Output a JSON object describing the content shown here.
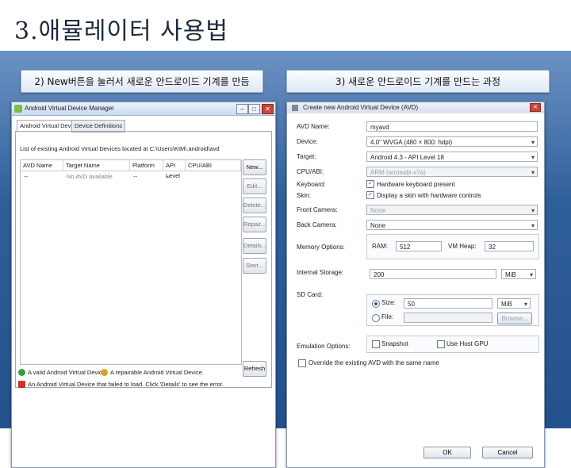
{
  "slide": {
    "title": "3.애뮬레이터 사용법",
    "caption_left": "2) New버튼을 눌러서 새로운 안드로이드 기계를 만듬",
    "caption_right": "3) 새로운 안드로이드 기계를 만드는 과정"
  },
  "avd_manager": {
    "window_title": "Android Virtual Device Manager",
    "minimize": "–",
    "maximize": "□",
    "close": "✕",
    "tabs": [
      "Android Virtual Devices",
      "Device Definitions"
    ],
    "list_caption": "List of existing Android Virtual Devices located at C:\\Users\\KIM\\.android\\avd",
    "columns": [
      "AVD Name",
      "Target Name",
      "Platform",
      "API Level",
      "CPU/ABI"
    ],
    "row": [
      "--",
      "No AVD available",
      "--",
      "--"
    ],
    "buttons": [
      "New...",
      "Edit...",
      "Delete...",
      "Repair...",
      "Details...",
      "Start..."
    ],
    "refresh": "Refresh",
    "legend": [
      "A valid Android Virtual Device.",
      "A repairable Android Virtual Device.",
      "An Android Virtual Device that failed to load. Click 'Details' to see the error."
    ],
    "colors": {
      "valid": "#3e9b3a",
      "repairable": "#d9a12b",
      "failed": "#c8342c"
    }
  },
  "create_avd": {
    "window_title": "Create new Android Virtual Device (AVD)",
    "labels": {
      "name": "AVD Name:",
      "device": "Device:",
      "target": "Target:",
      "cpu": "CPU/ABI:",
      "keyboard": "Keyboard:",
      "skin": "Skin:",
      "front": "Front Camera:",
      "back": "Back Camera:",
      "memory": "Memory Options:",
      "internal": "Internal Storage:",
      "sdcard": "SD Card:",
      "emulation": "Emulation Options:"
    },
    "values": {
      "name": "myavd",
      "device": "4.0\" WVGA (480 × 800: hdpi)",
      "target": "Android 4.3 - API Level 18",
      "cpu": "ARM (armeabi-v7a)",
      "keyboard": "Hardware keyboard present",
      "skin": "Display a skin with hardware controls",
      "front": "None",
      "back": "None",
      "ram_label": "RAM:",
      "ram": "512",
      "heap_label": "VM Heap:",
      "heap": "32",
      "internal": "200",
      "internal_unit": "MiB",
      "size_label": "Size:",
      "size": "50",
      "size_unit": "MiB",
      "file_label": "File:",
      "browse": "Browse...",
      "snapshot": "Snapshot",
      "host_gpu": "Use Host GPU",
      "override": "Override the existing AVD with the same name",
      "ok": "OK",
      "cancel": "Cancel"
    }
  }
}
